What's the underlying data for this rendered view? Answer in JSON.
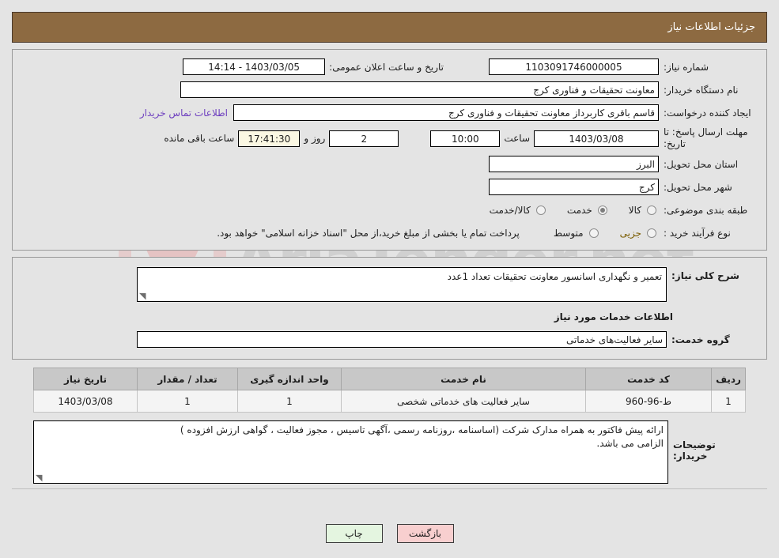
{
  "header": {
    "title": "جزئیات اطلاعات نیاز"
  },
  "watermark": {
    "text": "AriaTender.net"
  },
  "form": {
    "need_number_label": "شماره نیاز:",
    "need_number_value": "1103091746000005",
    "public_announce_label": "تاریخ و ساعت اعلان عمومی:",
    "public_announce_value": "1403/03/05 - 14:14",
    "buyer_org_label": "نام دستگاه خریدار:",
    "buyer_org_value": "معاونت تحقیقات و فناوری کرج",
    "requester_label": "ایجاد کننده درخواست:",
    "requester_value": "قاسم باقری کاربرداز معاونت تحقیقات و فناوری کرج",
    "contact_link": "اطلاعات تماس خریدار",
    "deadline_label": "مهلت ارسال پاسخ: تا تاریخ:",
    "deadline_date": "1403/03/08",
    "deadline_hour_label": "ساعت",
    "deadline_hour": "10:00",
    "days_value": "2",
    "days_label": "روز و",
    "countdown_value": "17:41:30",
    "countdown_label": "ساعت باقی مانده",
    "province_label": "استان محل تحویل:",
    "province_value": "البرز",
    "city_label": "شهر محل تحویل:",
    "city_value": "کرج",
    "category_label": "طبقه بندی موضوعی:",
    "category_options": [
      {
        "label": "کالا",
        "selected": false
      },
      {
        "label": "خدمت",
        "selected": true
      },
      {
        "label": "کالا/خدمت",
        "selected": false
      }
    ],
    "process_label": "نوع فرآیند خرید :",
    "process_options": [
      {
        "label": "جزیی",
        "selected": false
      },
      {
        "label": "متوسط",
        "selected": false
      }
    ],
    "process_note": "پرداخت تمام یا بخشی از مبلغ خرید،از محل \"اسناد خزانه اسلامی\" خواهد بود."
  },
  "need_summary": {
    "label": "شرح کلی نیاز:",
    "value": "تعمیر و نگهداری اسانسور معاونت تحقیقات تعداد 1عدد"
  },
  "services": {
    "section_title": "اطلاعات خدمات مورد نیاز",
    "group_label": "گروه خدمت:",
    "group_value": "سایر فعالیت‌های خدماتی",
    "columns": [
      "ردیف",
      "کد خدمت",
      "نام خدمت",
      "واحد اندازه گیری",
      "تعداد / مقدار",
      "تاریخ نیاز"
    ],
    "rows": [
      {
        "index": "1",
        "code": "ط-96-960",
        "name": "سایر فعالیت های خدماتی شخصی",
        "unit": "1",
        "quantity": "1",
        "date": "1403/03/08"
      }
    ]
  },
  "buyer_notes": {
    "label": "توضیحات خریدار:",
    "line1": "ارائه پیش فاکتور به همراه مدارک شرکت (اساسنامه ،روزنامه رسمی ،آگهی تاسیس ، مجوز فعالیت ، گواهی ارزش افزوده )",
    "line2": "الزامی می باشد."
  },
  "footer": {
    "back_label": "بازگشت",
    "print_label": "چاپ"
  },
  "colors": {
    "titlebar": "#8d6a41",
    "link": "#6e3fbf",
    "back_button": "#f8cfcf",
    "print_button": "#e4f5e0",
    "countdown_bg": "#fbf8e3",
    "page_bg": "#e4e4e4"
  }
}
